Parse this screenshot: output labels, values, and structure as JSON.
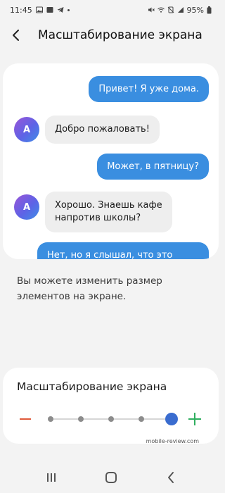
{
  "status_bar": {
    "time": "11:45",
    "battery": "95%"
  },
  "header": {
    "title": "Масштабирование экрана"
  },
  "preview": {
    "messages": [
      {
        "direction": "out",
        "text": "Привет! Я уже дома."
      },
      {
        "direction": "in",
        "avatar": "A",
        "text": "Добро пожаловать!"
      },
      {
        "direction": "out",
        "text": "Может, в пятницу?"
      },
      {
        "direction": "in",
        "avatar": "A",
        "line1": "Хорошо. Знаешь кафе",
        "line2": "напротив школы?"
      },
      {
        "direction": "out",
        "text": "Нет, но я слышал, что это"
      }
    ]
  },
  "description": {
    "line1": "Вы можете изменить размер",
    "line2": "элементов на экране."
  },
  "scale": {
    "title": "Масштабирование экрана",
    "levels": 5,
    "selected_level": 5,
    "minus_color": "#e05a3a",
    "plus_color": "#2fae5f",
    "thumb_color": "#3a6ccf"
  },
  "watermark": "mobile-review.com",
  "colors": {
    "outgoing_bubble": "#3a8ee0",
    "incoming_bubble": "#eeeeee"
  },
  "icons": [
    "back-arrow-icon",
    "minus-icon",
    "plus-icon",
    "recents-icon",
    "home-icon",
    "back-nav-icon"
  ]
}
